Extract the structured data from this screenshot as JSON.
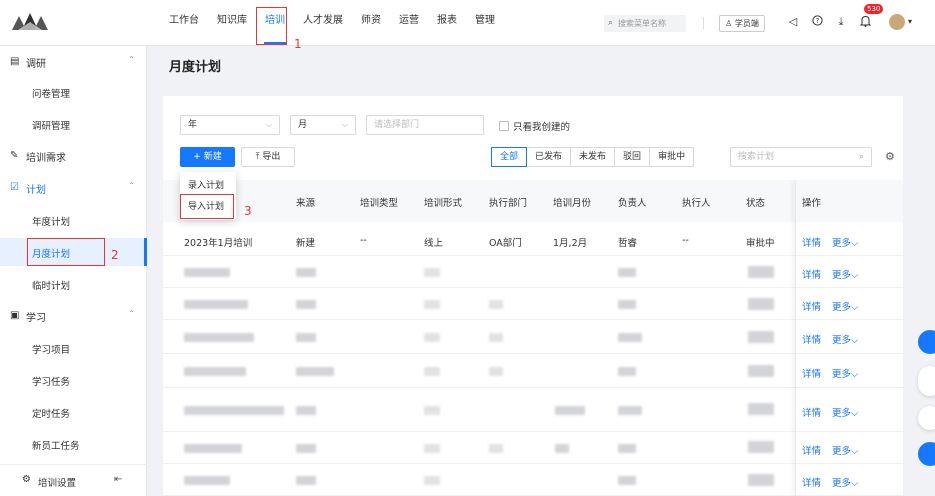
{
  "topbar": {
    "nav": [
      "工作台",
      "知识库",
      "培训",
      "人才发展",
      "师资",
      "运营",
      "报表",
      "管理"
    ],
    "active_nav": "培训",
    "search_placeholder": "搜索菜单名称",
    "student_btn": "学员端",
    "notification_count": "530",
    "icons": [
      "megaphone-icon",
      "help-icon",
      "download-icon",
      "bell-icon",
      "avatar"
    ]
  },
  "sidebar": {
    "groups": [
      {
        "label": "调研",
        "icon": "survey-icon",
        "items": [
          "问卷管理",
          "调研管理"
        ]
      },
      {
        "label": "培训需求",
        "icon": "edit-icon",
        "items": []
      },
      {
        "label": "计划",
        "icon": "plan-icon",
        "items": [
          "年度计划",
          "月度计划",
          "临时计划"
        ]
      },
      {
        "label": "学习",
        "icon": "learn-icon",
        "items": [
          "学习项目",
          "学习任务",
          "定时任务",
          "新员工任务"
        ]
      }
    ],
    "active_item": "月度计划",
    "footer": {
      "label": "培训设置",
      "icon": "settings-icon",
      "collapse_icon": "collapse-icon"
    }
  },
  "page": {
    "title": "月度计划"
  },
  "filters": {
    "year": "年",
    "month": "月",
    "dept_placeholder": "请选择部门",
    "only_mine_label": "只看我创建的"
  },
  "toolbar": {
    "new_label": "+ 新建",
    "export_label": "导出",
    "status_tabs": [
      "全部",
      "已发布",
      "未发布",
      "驳回",
      "审批中"
    ],
    "active_status": "全部",
    "search_placeholder": "搜索计划"
  },
  "dropdown": {
    "items": [
      "录入计划",
      "导入计划"
    ]
  },
  "annotations": [
    "1",
    "2",
    "3"
  ],
  "table": {
    "columns": [
      "来源",
      "培训类型",
      "培训形式",
      "执行部门",
      "培训月份",
      "负责人",
      "执行人",
      "状态",
      "操作"
    ],
    "first_row": {
      "name": "2023年1月培训",
      "source": "新建",
      "type": "--",
      "form": "线上",
      "dept": "OA部门",
      "months": "1月,2月",
      "owner": "哲睿",
      "executor": "--",
      "status": "审批中"
    },
    "actions": {
      "detail": "详情",
      "more": "更多"
    }
  },
  "colors": {
    "accent": "#1677ff",
    "annotation": "#e33333"
  }
}
